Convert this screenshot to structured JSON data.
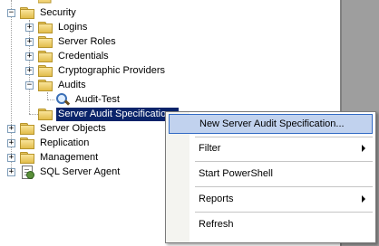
{
  "tree": {
    "items": [
      {
        "label": "Security",
        "expander": "−"
      },
      {
        "label": "Logins",
        "expander": "+"
      },
      {
        "label": "Server Roles",
        "expander": "+"
      },
      {
        "label": "Credentials",
        "expander": "+"
      },
      {
        "label": "Cryptographic Providers",
        "expander": "+"
      },
      {
        "label": "Audits",
        "expander": "−"
      },
      {
        "label": "Audit-Test"
      },
      {
        "label": "Server Audit Specifications"
      },
      {
        "label": "Server Objects",
        "expander": "+"
      },
      {
        "label": "Replication",
        "expander": "+"
      },
      {
        "label": "Management",
        "expander": "+"
      },
      {
        "label": "SQL Server Agent",
        "expander": "+"
      }
    ]
  },
  "context_menu": {
    "items": [
      {
        "label": "New Server Audit Specification..."
      },
      {
        "label": "Filter"
      },
      {
        "label": "Start PowerShell"
      },
      {
        "label": "Reports"
      },
      {
        "label": "Refresh"
      }
    ]
  },
  "colors": {
    "selection": "#0a246a",
    "menu_highlight": "#c1d2ee",
    "menu_highlight_border": "#316ac5",
    "folder": "#f9e49a",
    "right_pane": "#9e9e9e"
  }
}
